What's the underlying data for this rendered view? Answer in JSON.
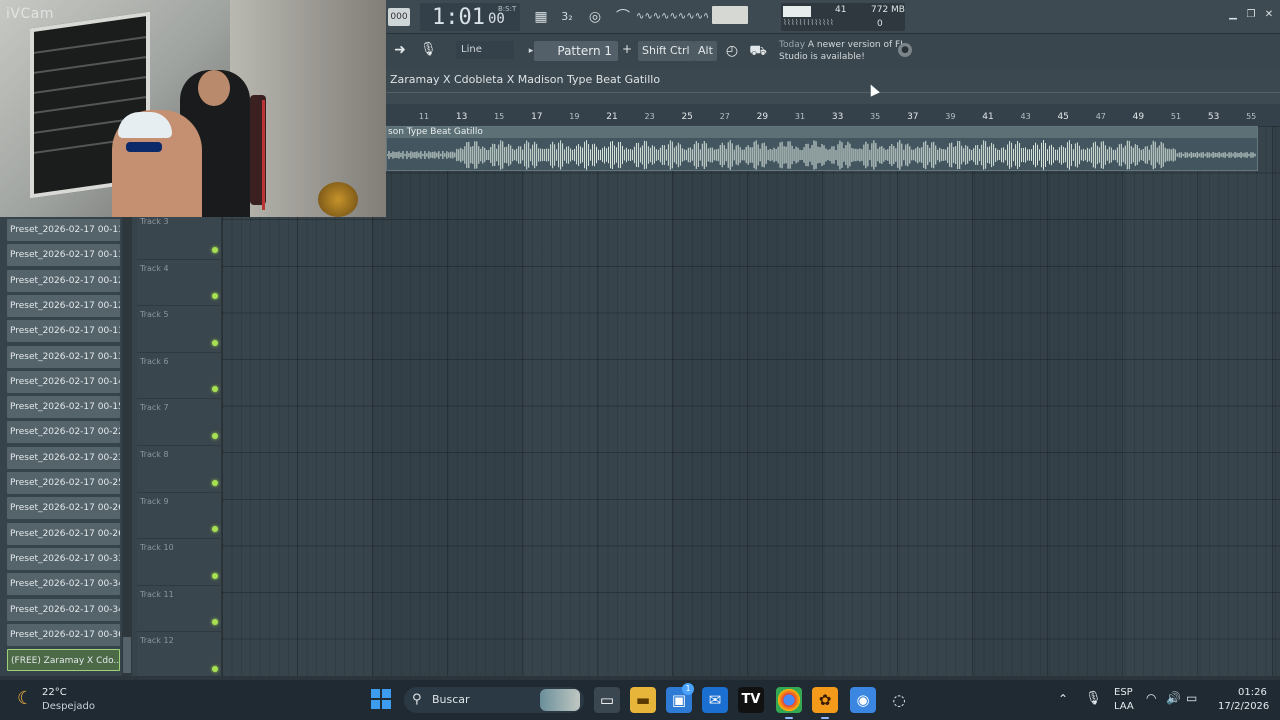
{
  "webcam": {
    "label": "iVCam"
  },
  "toolbar": {
    "tempo": "000",
    "time_main": "1:01",
    "time_sub": "00",
    "time_small": "B:S:T",
    "cpu_value": "41",
    "ram_value": "772 MB",
    "voices_value": "0",
    "line_mode": "Line",
    "pattern": "Pattern 1",
    "shift_label": "Shift",
    "ctrl_label": "Ctrl",
    "alt_label": "Alt",
    "news_today": "Today",
    "news_text": "A newer version of FL Studio is available!"
  },
  "playlist": {
    "title": "(FREE) Zaramay X Cdobleta X Madison Type Beat Gatillo",
    "clip_name": "son Type Beat Gatillo",
    "ruler": [
      {
        "n": "11",
        "big": false
      },
      {
        "n": "13",
        "big": true
      },
      {
        "n": "15",
        "big": false
      },
      {
        "n": "17",
        "big": true
      },
      {
        "n": "19",
        "big": false
      },
      {
        "n": "21",
        "big": true
      },
      {
        "n": "23",
        "big": false
      },
      {
        "n": "25",
        "big": true
      },
      {
        "n": "27",
        "big": false
      },
      {
        "n": "29",
        "big": true
      },
      {
        "n": "31",
        "big": false
      },
      {
        "n": "33",
        "big": true
      },
      {
        "n": "35",
        "big": false
      },
      {
        "n": "37",
        "big": true
      },
      {
        "n": "39",
        "big": false
      },
      {
        "n": "41",
        "big": true
      },
      {
        "n": "43",
        "big": false
      },
      {
        "n": "45",
        "big": true
      },
      {
        "n": "47",
        "big": false
      },
      {
        "n": "49",
        "big": true
      },
      {
        "n": "51",
        "big": false
      },
      {
        "n": "53",
        "big": true
      },
      {
        "n": "55",
        "big": false
      }
    ],
    "tracks": [
      "Track 3",
      "Track 4",
      "Track 5",
      "Track 6",
      "Track 7",
      "Track 8",
      "Track 9",
      "Track 10",
      "Track 11",
      "Track 12"
    ]
  },
  "browser": {
    "presets": [
      "Preset_2026-02-17 00-11...",
      "Preset_2026-02-17 00-11...",
      "Preset_2026-02-17 00-12...",
      "Preset_2026-02-17 00-12...",
      "Preset_2026-02-17 00-13...",
      "Preset_2026-02-17 00-13...",
      "Preset_2026-02-17 00-14...",
      "Preset_2026-02-17 00-15...",
      "Preset_2026-02-17 00-22...",
      "Preset_2026-02-17 00-23...",
      "Preset_2026-02-17 00-25...",
      "Preset_2026-02-17 00-26...",
      "Preset_2026-02-17 00-26...",
      "Preset_2026-02-17 00-33...",
      "Preset_2026-02-17 00-34...",
      "Preset_2026-02-17 00-34...",
      "Preset_2026-02-17 00-36..."
    ],
    "selected": "(FREE) Zaramay X Cdo..."
  },
  "taskbar": {
    "temperature": "22°C",
    "condition": "Despejado",
    "search_placeholder": "Buscar",
    "lang": "ESP",
    "lang_sub": "LAA",
    "time": "01:26",
    "date": "17/2/2026",
    "mail_badge": "1"
  }
}
